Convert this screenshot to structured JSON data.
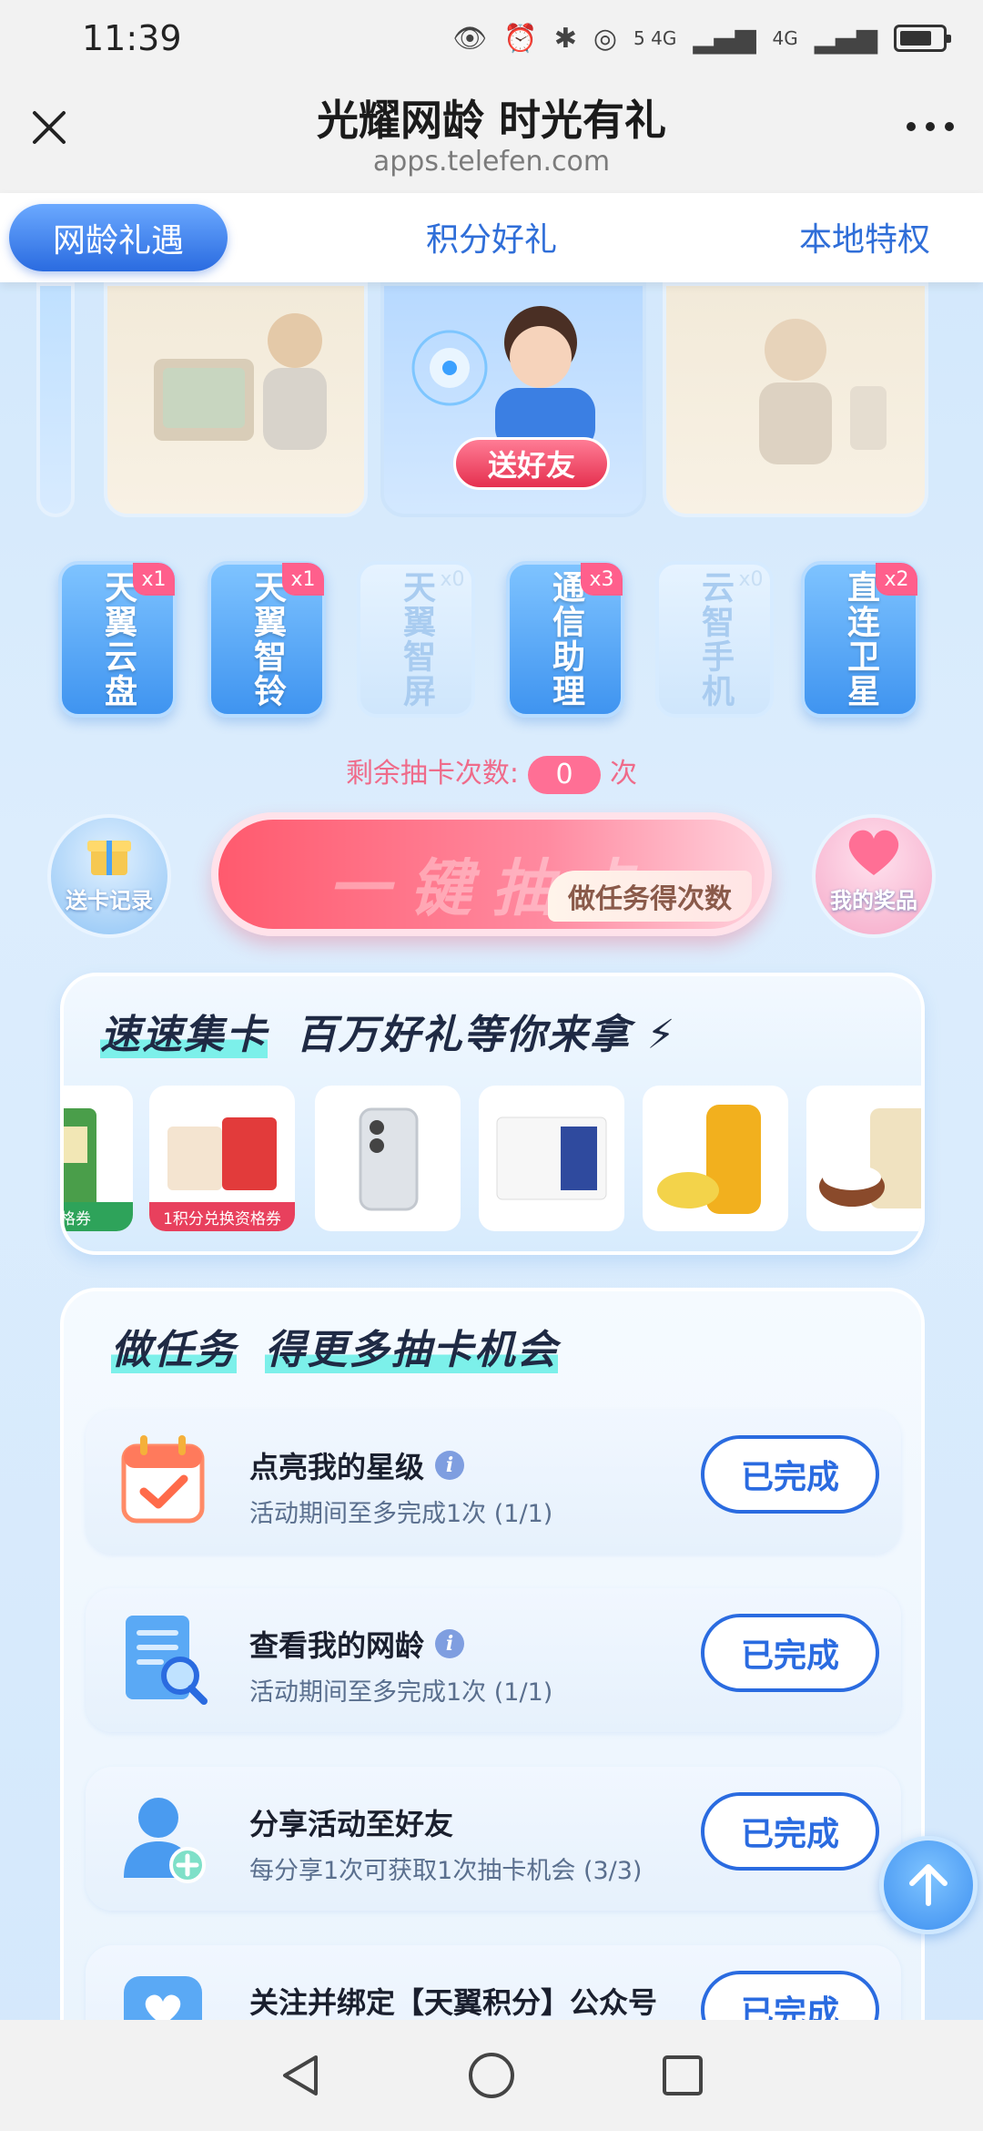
{
  "status": {
    "time": "11:39",
    "net1": "5 4G",
    "net2": "4G"
  },
  "header": {
    "title": "光耀网龄 时光有礼",
    "url": "apps.telefen.com"
  },
  "tabs": [
    {
      "label": "网龄礼遇",
      "active": true
    },
    {
      "label": "积分好礼",
      "active": false
    },
    {
      "label": "本地特权",
      "active": false
    }
  ],
  "banner": {
    "send_friend_label": "送好友"
  },
  "cards": [
    {
      "name": "天翼云盘",
      "badge": "x1",
      "owned": true
    },
    {
      "name": "天翼智铃",
      "badge": "x1",
      "owned": true
    },
    {
      "name": "天翼智屏",
      "badge": "x0",
      "owned": false
    },
    {
      "name": "通信助理",
      "badge": "x3",
      "owned": true
    },
    {
      "name": "云智手机",
      "badge": "x0",
      "owned": false
    },
    {
      "name": "直连卫星",
      "badge": "x2",
      "owned": true
    }
  ],
  "remain": {
    "prefix": "剩余抽卡次数:",
    "count": "0",
    "suffix": "次"
  },
  "actions": {
    "send_record_label": "送卡记录",
    "draw_label": "一键抽卡",
    "task_sub_label": "做任务得次数",
    "my_prize_label": "我的奖品"
  },
  "prize_section": {
    "title_a": "速速集卡",
    "title_b": "百万好礼",
    "title_c": "等你来拿",
    "items": [
      {
        "tag": "换资格券"
      },
      {
        "tag": "1积分兑换资格券"
      },
      {
        "tag": ""
      },
      {
        "tag": ""
      },
      {
        "tag": ""
      },
      {
        "tag": ""
      }
    ]
  },
  "task_section": {
    "title_a": "做任务",
    "title_b": "得更多抽卡机会",
    "tasks": [
      {
        "name": "点亮我的星级",
        "desc": "活动期间至多完成1次 (1/1)",
        "button": "已完成",
        "info": true
      },
      {
        "name": "查看我的网龄",
        "desc": "活动期间至多完成1次 (1/1)",
        "button": "已完成",
        "info": true
      },
      {
        "name": "分享活动至好友",
        "desc": "每分享1次可获取1次抽卡机会 (3/3)",
        "button": "已完成",
        "info": false
      },
      {
        "name": "关注并绑定【天翼积分】公众号",
        "desc": "",
        "button": "已完成",
        "info": false
      }
    ]
  },
  "colors": {
    "accent": "#2a6be0",
    "pink": "#ff6f95"
  }
}
